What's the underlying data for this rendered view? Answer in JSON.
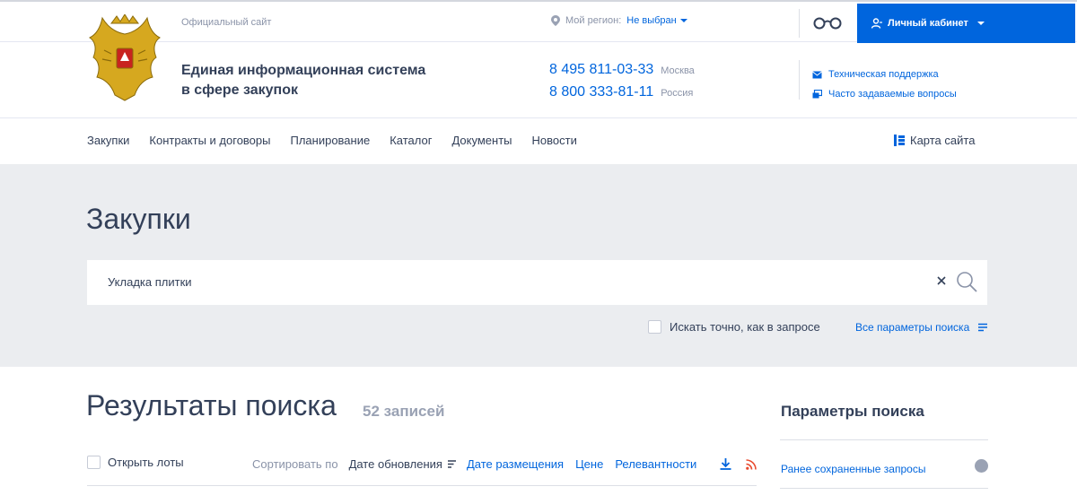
{
  "header": {
    "official_label": "Официальный сайт",
    "region_label": "Мой регион:",
    "region_value": "Не выбран",
    "cabinet_label": "Личный кабинет",
    "system_name_line1": "Единая информационная система",
    "system_name_line2": "в сфере закупок",
    "phones": [
      {
        "number": "8 495 811-03-33",
        "location": "Москва"
      },
      {
        "number": "8 800 333-81-11",
        "location": "Россия"
      }
    ],
    "support_label": "Техническая поддержка",
    "faq_label": "Часто задаваемые вопросы"
  },
  "nav": {
    "items": [
      "Закупки",
      "Контракты и договоры",
      "Планирование",
      "Каталог",
      "Документы",
      "Новости"
    ],
    "sitemap_label": "Карта сайта"
  },
  "search": {
    "title": "Закупки",
    "query": "Укладка плитки",
    "exact_label": "Искать точно, как в запросе",
    "all_params_label": "Все параметры поиска"
  },
  "results": {
    "title": "Результаты поиска",
    "count_label": "52 записей",
    "open_lots_label": "Открыть лоты",
    "sort_by_label": "Сортировать по",
    "sort_options": [
      {
        "label": "Дате обновления",
        "active": true
      },
      {
        "label": "Дате размещения",
        "active": false
      },
      {
        "label": "Цене",
        "active": false
      },
      {
        "label": "Релевантности",
        "active": false
      }
    ]
  },
  "sidebar": {
    "title": "Параметры поиска",
    "saved_queries_label": "Ранее сохраненные запросы"
  },
  "icons": {
    "region": "map-pin-icon",
    "accessibility": "glasses-icon",
    "cabinet": "user-icon",
    "support": "mail-icon",
    "faq": "chat-icon",
    "sitemap": "sitemap-icon",
    "clear": "close-icon",
    "search": "search-icon",
    "params": "filter-lines-icon",
    "download": "download-icon",
    "rss": "rss-icon"
  },
  "colors": {
    "accent": "#0065dd",
    "text": "#334059",
    "muted": "#8a93a8",
    "band": "#ebedf0",
    "rss": "#e84a2e"
  }
}
